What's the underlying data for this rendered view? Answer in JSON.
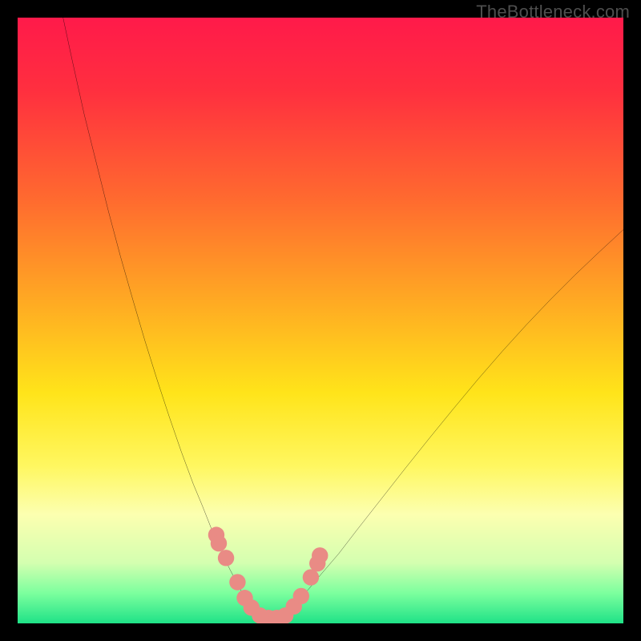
{
  "watermark": "TheBottleneck.com",
  "chart_data": {
    "type": "line",
    "title": "",
    "xlabel": "",
    "ylabel": "",
    "xlim": [
      0,
      100
    ],
    "ylim": [
      0,
      100
    ],
    "gradient_stops": [
      {
        "offset": 0.0,
        "color": "#ff1a4a"
      },
      {
        "offset": 0.12,
        "color": "#ff2f3f"
      },
      {
        "offset": 0.3,
        "color": "#ff6a2f"
      },
      {
        "offset": 0.48,
        "color": "#ffae22"
      },
      {
        "offset": 0.62,
        "color": "#ffe41a"
      },
      {
        "offset": 0.74,
        "color": "#fff760"
      },
      {
        "offset": 0.82,
        "color": "#fcffb0"
      },
      {
        "offset": 0.9,
        "color": "#d4ffb0"
      },
      {
        "offset": 0.95,
        "color": "#7cff9e"
      },
      {
        "offset": 1.0,
        "color": "#1fe287"
      }
    ],
    "series": [
      {
        "name": "left-curve",
        "x": [
          7.5,
          9,
          11,
          13,
          15,
          17,
          19,
          21,
          23,
          25,
          27,
          29,
          30.5,
          32,
          33.5,
          35,
          36.5,
          38
        ],
        "values": [
          100,
          93,
          84,
          76,
          68,
          60.5,
          53.5,
          46.7,
          40.3,
          34.2,
          28.4,
          23,
          19.4,
          15.6,
          12.1,
          9.0,
          6.1,
          3.5
        ]
      },
      {
        "name": "right-curve",
        "x": [
          46,
          48,
          50,
          53,
          56,
          60,
          64,
          68,
          72,
          76,
          80,
          84,
          88,
          92,
          96,
          100
        ],
        "values": [
          3.5,
          5.6,
          8.0,
          11.5,
          15.4,
          20.5,
          25.6,
          30.6,
          35.5,
          40.3,
          44.9,
          49.3,
          53.5,
          57.5,
          61.3,
          65.0
        ]
      },
      {
        "name": "bottom-link",
        "x": [
          38,
          39,
          40,
          41,
          42,
          43,
          44,
          45,
          46
        ],
        "values": [
          3.5,
          1.7,
          0.9,
          0.6,
          0.5,
          0.6,
          0.9,
          1.7,
          3.5
        ]
      }
    ],
    "markers": {
      "name": "bead-cluster",
      "color": "#e98b85",
      "points": [
        {
          "x": 32.8,
          "y": 14.6
        },
        {
          "x": 33.2,
          "y": 13.2
        },
        {
          "x": 34.4,
          "y": 10.8
        },
        {
          "x": 36.3,
          "y": 6.8
        },
        {
          "x": 37.5,
          "y": 4.2
        },
        {
          "x": 38.6,
          "y": 2.6
        },
        {
          "x": 40.0,
          "y": 1.3
        },
        {
          "x": 41.4,
          "y": 0.9
        },
        {
          "x": 42.8,
          "y": 0.9
        },
        {
          "x": 44.2,
          "y": 1.3
        },
        {
          "x": 45.6,
          "y": 2.8
        },
        {
          "x": 46.8,
          "y": 4.5
        },
        {
          "x": 48.4,
          "y": 7.6
        },
        {
          "x": 49.5,
          "y": 9.9
        },
        {
          "x": 49.9,
          "y": 11.2
        }
      ]
    }
  }
}
